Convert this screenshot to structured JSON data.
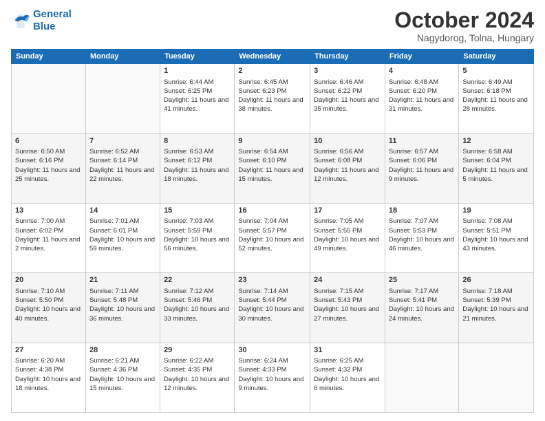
{
  "logo": {
    "line1": "General",
    "line2": "Blue"
  },
  "header": {
    "month": "October 2024",
    "location": "Nagydorog, Tolna, Hungary"
  },
  "weekdays": [
    "Sunday",
    "Monday",
    "Tuesday",
    "Wednesday",
    "Thursday",
    "Friday",
    "Saturday"
  ],
  "weeks": [
    [
      {
        "day": "",
        "info": ""
      },
      {
        "day": "",
        "info": ""
      },
      {
        "day": "1",
        "info": "Sunrise: 6:44 AM\nSunset: 6:25 PM\nDaylight: 11 hours and 41 minutes."
      },
      {
        "day": "2",
        "info": "Sunrise: 6:45 AM\nSunset: 6:23 PM\nDaylight: 11 hours and 38 minutes."
      },
      {
        "day": "3",
        "info": "Sunrise: 6:46 AM\nSunset: 6:22 PM\nDaylight: 11 hours and 35 minutes."
      },
      {
        "day": "4",
        "info": "Sunrise: 6:48 AM\nSunset: 6:20 PM\nDaylight: 11 hours and 31 minutes."
      },
      {
        "day": "5",
        "info": "Sunrise: 6:49 AM\nSunset: 6:18 PM\nDaylight: 11 hours and 28 minutes."
      }
    ],
    [
      {
        "day": "6",
        "info": "Sunrise: 6:50 AM\nSunset: 6:16 PM\nDaylight: 11 hours and 25 minutes."
      },
      {
        "day": "7",
        "info": "Sunrise: 6:52 AM\nSunset: 6:14 PM\nDaylight: 11 hours and 22 minutes."
      },
      {
        "day": "8",
        "info": "Sunrise: 6:53 AM\nSunset: 6:12 PM\nDaylight: 11 hours and 18 minutes."
      },
      {
        "day": "9",
        "info": "Sunrise: 6:54 AM\nSunset: 6:10 PM\nDaylight: 11 hours and 15 minutes."
      },
      {
        "day": "10",
        "info": "Sunrise: 6:56 AM\nSunset: 6:08 PM\nDaylight: 11 hours and 12 minutes."
      },
      {
        "day": "11",
        "info": "Sunrise: 6:57 AM\nSunset: 6:06 PM\nDaylight: 11 hours and 9 minutes."
      },
      {
        "day": "12",
        "info": "Sunrise: 6:58 AM\nSunset: 6:04 PM\nDaylight: 11 hours and 5 minutes."
      }
    ],
    [
      {
        "day": "13",
        "info": "Sunrise: 7:00 AM\nSunset: 6:02 PM\nDaylight: 11 hours and 2 minutes."
      },
      {
        "day": "14",
        "info": "Sunrise: 7:01 AM\nSunset: 6:01 PM\nDaylight: 10 hours and 59 minutes."
      },
      {
        "day": "15",
        "info": "Sunrise: 7:03 AM\nSunset: 5:59 PM\nDaylight: 10 hours and 56 minutes."
      },
      {
        "day": "16",
        "info": "Sunrise: 7:04 AM\nSunset: 5:57 PM\nDaylight: 10 hours and 52 minutes."
      },
      {
        "day": "17",
        "info": "Sunrise: 7:05 AM\nSunset: 5:55 PM\nDaylight: 10 hours and 49 minutes."
      },
      {
        "day": "18",
        "info": "Sunrise: 7:07 AM\nSunset: 5:53 PM\nDaylight: 10 hours and 46 minutes."
      },
      {
        "day": "19",
        "info": "Sunrise: 7:08 AM\nSunset: 5:51 PM\nDaylight: 10 hours and 43 minutes."
      }
    ],
    [
      {
        "day": "20",
        "info": "Sunrise: 7:10 AM\nSunset: 5:50 PM\nDaylight: 10 hours and 40 minutes."
      },
      {
        "day": "21",
        "info": "Sunrise: 7:11 AM\nSunset: 5:48 PM\nDaylight: 10 hours and 36 minutes."
      },
      {
        "day": "22",
        "info": "Sunrise: 7:12 AM\nSunset: 5:46 PM\nDaylight: 10 hours and 33 minutes."
      },
      {
        "day": "23",
        "info": "Sunrise: 7:14 AM\nSunset: 5:44 PM\nDaylight: 10 hours and 30 minutes."
      },
      {
        "day": "24",
        "info": "Sunrise: 7:15 AM\nSunset: 5:43 PM\nDaylight: 10 hours and 27 minutes."
      },
      {
        "day": "25",
        "info": "Sunrise: 7:17 AM\nSunset: 5:41 PM\nDaylight: 10 hours and 24 minutes."
      },
      {
        "day": "26",
        "info": "Sunrise: 7:18 AM\nSunset: 5:39 PM\nDaylight: 10 hours and 21 minutes."
      }
    ],
    [
      {
        "day": "27",
        "info": "Sunrise: 6:20 AM\nSunset: 4:38 PM\nDaylight: 10 hours and 18 minutes."
      },
      {
        "day": "28",
        "info": "Sunrise: 6:21 AM\nSunset: 4:36 PM\nDaylight: 10 hours and 15 minutes."
      },
      {
        "day": "29",
        "info": "Sunrise: 6:22 AM\nSunset: 4:35 PM\nDaylight: 10 hours and 12 minutes."
      },
      {
        "day": "30",
        "info": "Sunrise: 6:24 AM\nSunset: 4:33 PM\nDaylight: 10 hours and 9 minutes."
      },
      {
        "day": "31",
        "info": "Sunrise: 6:25 AM\nSunset: 4:32 PM\nDaylight: 10 hours and 6 minutes."
      },
      {
        "day": "",
        "info": ""
      },
      {
        "day": "",
        "info": ""
      }
    ]
  ]
}
